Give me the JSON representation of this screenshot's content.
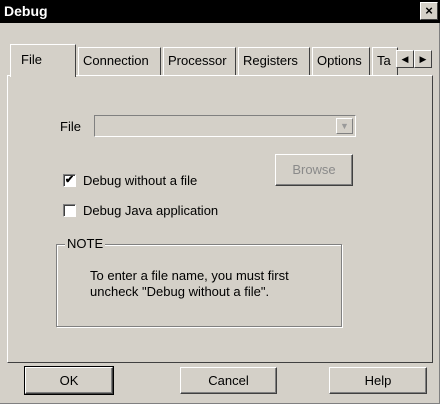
{
  "window": {
    "title": "Debug",
    "close_glyph": "×"
  },
  "tabs": [
    {
      "label": "File",
      "active": true
    },
    {
      "label": "Connection"
    },
    {
      "label": "Processor"
    },
    {
      "label": "Registers"
    },
    {
      "label": "Options"
    },
    {
      "label": "Ta"
    }
  ],
  "tab_scroll": {
    "left_glyph": "◀",
    "right_glyph": "▶"
  },
  "file_tab": {
    "file_label": "File",
    "file_value": "",
    "dropdown_glyph": "▼",
    "browse_label": "Browse",
    "debug_without_file": {
      "label": "Debug without a file",
      "checked": true,
      "glyph": "✔"
    },
    "debug_java": {
      "label": "Debug Java application",
      "checked": false
    },
    "note": {
      "legend": "NOTE",
      "line1": "To enter a file name, you must first",
      "line2": "uncheck \"Debug without a file\"."
    }
  },
  "buttons": {
    "ok": "OK",
    "cancel": "Cancel",
    "help": "Help"
  },
  "colors": {
    "face": "#d4d0c8",
    "titlebar": "#000000",
    "disabled_text": "#8a8a8a"
  }
}
